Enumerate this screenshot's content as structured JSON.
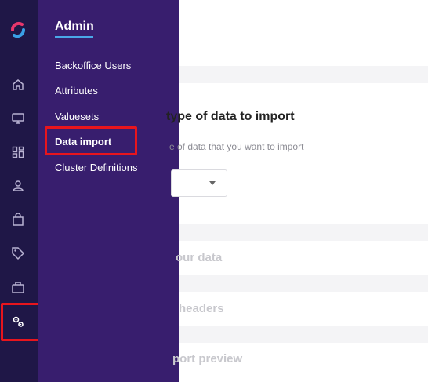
{
  "sidebar": {
    "icons": [
      {
        "name": "home-icon"
      },
      {
        "name": "monitor-icon"
      },
      {
        "name": "dashboard-icon"
      },
      {
        "name": "user-icon"
      },
      {
        "name": "shopping-bag-icon"
      },
      {
        "name": "tag-icon"
      },
      {
        "name": "briefcase-icon"
      },
      {
        "name": "settings-gears-icon"
      }
    ]
  },
  "flyout": {
    "title": "Admin",
    "items": [
      {
        "label": "Backoffice Users"
      },
      {
        "label": "Attributes"
      },
      {
        "label": "Valuesets"
      },
      {
        "label": "Data import"
      },
      {
        "label": "Cluster Definitions"
      }
    ],
    "active_item": "Data import"
  },
  "main": {
    "step1_title": "type of data to import",
    "step1_subtitle": "e of data that you want to import",
    "step2_title": "our data",
    "step3_title": "headers",
    "step4_title": "port preview"
  },
  "colors": {
    "rail": "#1f1747",
    "flyout": "#381e6e",
    "accent": "#4aa7e8",
    "highlight": "#e8151d"
  }
}
